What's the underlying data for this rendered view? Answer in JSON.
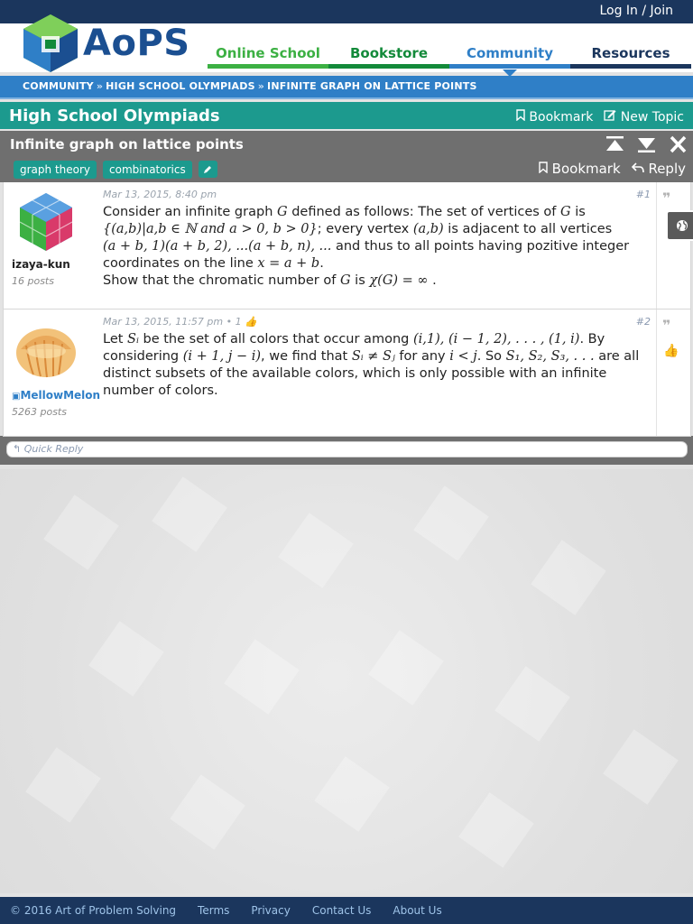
{
  "header": {
    "login": "Log In / Join",
    "logo_text": "AoPS",
    "nav": [
      "Online School",
      "Bookstore",
      "Community",
      "Resources"
    ]
  },
  "breadcrumb": [
    "COMMUNITY",
    "HIGH SCHOOL OLYMPIADS",
    "INFINITE GRAPH ON LATTICE POINTS"
  ],
  "forum": {
    "title": "High School Olympiads",
    "bookmark": "Bookmark",
    "new_topic": "New Topic"
  },
  "topic": {
    "title": "Infinite graph on lattice points",
    "tags": [
      "graph theory",
      "combinatorics"
    ],
    "bookmark": "Bookmark",
    "reply": "Reply"
  },
  "posts": [
    {
      "meta": "Mar 13, 2015, 8:40 pm",
      "num": "#1",
      "username": "izaya-kun",
      "postcount": "16 posts",
      "line1a": "Consider an infinite graph ",
      "m1": "G",
      "line1b": " defined as follows: The set of vertices of ",
      "m2": "G",
      "line1c": " is",
      "m3": "{(a,b)|a,b ∈ ℕ and a > 0, b > 0}",
      "line2a": "; every vertex ",
      "m4": "(a,b)",
      "line2b": " is adjacent to all vertices",
      "m5": "(a + b, 1)(a + b, 2), ...(a + b, n), ...",
      "line3a": " and thus to all points having pozitive integer coordinates on the line ",
      "m6": "x = a + b",
      "line3b": ".",
      "line4a": "Show that the chromatic number of ",
      "m7": "G",
      "line4b": " is ",
      "m8": "χ(G) = ∞",
      "line4c": " ."
    },
    {
      "meta": "Mar 13, 2015, 11:57 pm",
      "likes": "• 1",
      "num": "#2",
      "username": "MellowMelon",
      "postcount": "5263 posts",
      "t1": "Let ",
      "m1": "Sᵢ",
      "t2": " be the set of all colors that occur among ",
      "m2": "(i,1), (i − 1, 2), . . . , (1, i)",
      "t3": ". By considering ",
      "m3": "(i + 1, j − i)",
      "t4": ", we find that ",
      "m4": "Sᵢ ≠ Sⱼ",
      "t5": " for any ",
      "m5": "i < j",
      "t6": ". So ",
      "m6": "S₁, S₂, S₃, . . .",
      "t7": " are all distinct subsets of the available colors, which is only possible with an infinite number of colors."
    }
  ],
  "quick_reply": "Quick Reply",
  "footer": [
    "© 2016 Art of Problem Solving",
    "Terms",
    "Privacy",
    "Contact Us",
    "About Us"
  ],
  "colors": {
    "navy": "#1b365d",
    "teal": "#1c9a8e",
    "blue": "#2f7fc7",
    "green": "#3cb043",
    "darkgreen": "#138a3a",
    "gray": "#6f6f6f"
  }
}
